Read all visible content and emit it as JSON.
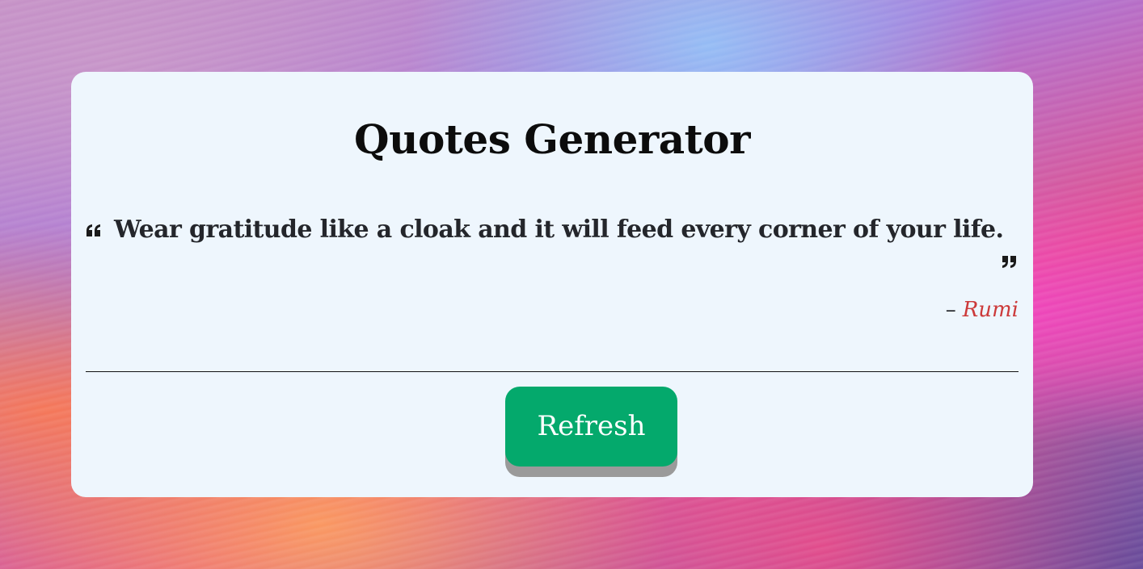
{
  "app": {
    "title": "Quotes Generator"
  },
  "quote": {
    "text": "Wear gratitude like a cloak and it will feed every corner of your life.",
    "dash": "–",
    "author": "Rumi",
    "open_icon": "quote-left-icon",
    "close_icon": "quote-right-icon"
  },
  "actions": {
    "refresh_label": "Refresh"
  },
  "colors": {
    "card_background": "#eef6fd",
    "button": "#04a96c",
    "button_shadow": "#9a9a9a",
    "author": "#cc3a3a",
    "text": "#24262b"
  }
}
